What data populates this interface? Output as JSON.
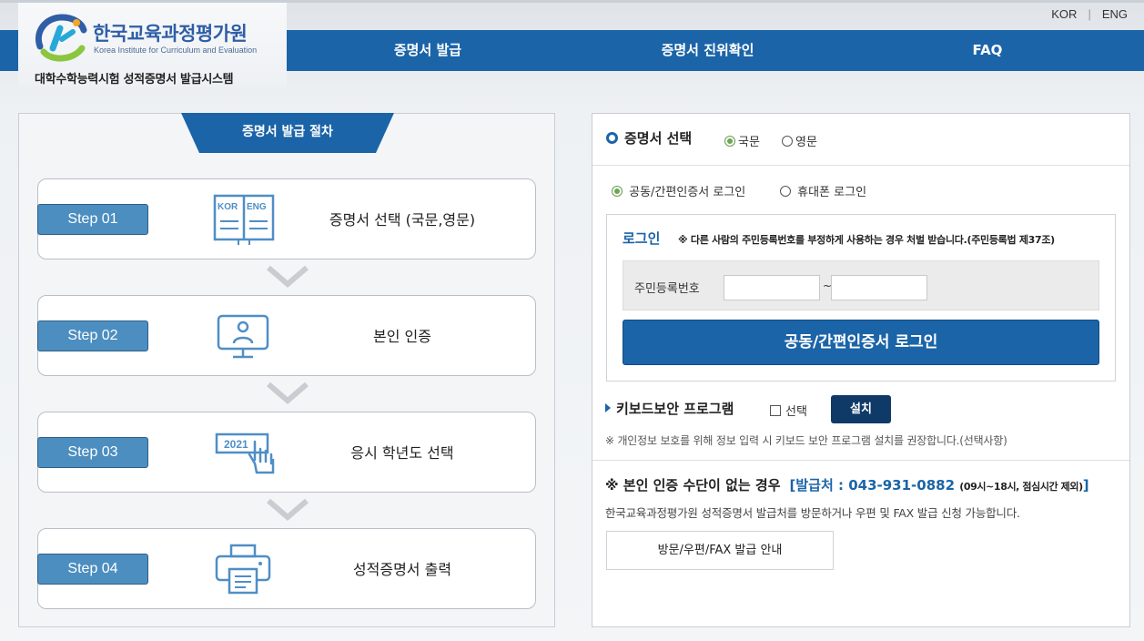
{
  "header": {
    "lang_kor": "KOR",
    "lang_eng": "ENG",
    "logo_ko": "한국교육과정평가원",
    "logo_en": "Korea Institute for Curriculum and Evaluation",
    "system_name": "대학수학능력시험 성적증명서 발급시스템"
  },
  "nav": {
    "items": [
      {
        "label": "증명서 발급"
      },
      {
        "label": "증명서 진위확인"
      },
      {
        "label": "FAQ"
      }
    ]
  },
  "procedure": {
    "title": "증명서 발급 절차",
    "steps": [
      {
        "badge": "Step 01",
        "text": "증명서 선택 (국문,영문)",
        "icon": "book-kor-eng-icon",
        "kor": "KOR",
        "eng": "ENG"
      },
      {
        "badge": "Step 02",
        "text": "본인 인증",
        "icon": "user-monitor-icon"
      },
      {
        "badge": "Step 03",
        "text": "응시 학년도 선택",
        "icon": "year-select-hand-icon",
        "year": "2021"
      },
      {
        "badge": "Step 04",
        "text": "성적증명서 출력",
        "icon": "printer-icon"
      }
    ]
  },
  "certificate": {
    "label": "증명서 선택",
    "options": [
      {
        "label": "국문",
        "selected": true
      },
      {
        "label": "영문",
        "selected": false
      }
    ]
  },
  "login_type": {
    "options": [
      {
        "label": "공동/간편인증서 로그인",
        "selected": true
      },
      {
        "label": "휴대폰 로그인",
        "selected": false
      }
    ]
  },
  "login": {
    "title": "로그인",
    "warning": "※ 다른 사람의 주민등록번호를 부정하게 사용하는 경우 처벌 받습니다.(주민등록법 제37조)",
    "rrn_label": "주민등록번호",
    "rrn_front": "",
    "rrn_back": "",
    "separator": "~",
    "button": "공동/간편인증서 로그인"
  },
  "keyboard": {
    "title": "키보드보안 프로그램",
    "checkbox_label": "선택",
    "checked": false,
    "install_button": "설치",
    "note": "※ 개인정보 보호를 위해 정보 입력 시 키보드 보안 프로그램 설치를 권장합니다.(선택사항)"
  },
  "no_auth": {
    "title": "※ 본인 인증 수단이 없는 경우",
    "phone": "[발급처 : 043-931-0882",
    "hours": "(09시~18시, 점심시간 제외)",
    "bracket_close": "]",
    "description": "한국교육과정평가원 성적증명서 발급처를 방문하거나 우편 및 FAX 발급 신청 가능합니다.",
    "button": "방문/우편/FAX 발급 안내"
  },
  "colors": {
    "primary": "#1b64a8",
    "dark_button": "#0f3a68",
    "step_badge": "#4c8ec0",
    "radio_selected": "#6aa84f"
  }
}
